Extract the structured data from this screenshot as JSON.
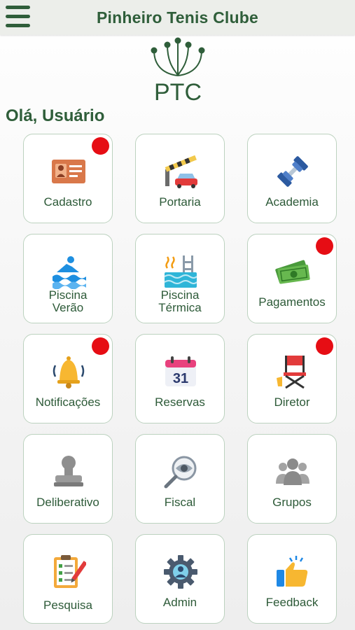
{
  "header": {
    "title": "Pinheiro Tenis Clube",
    "menu_icon": "hamburger-menu-icon"
  },
  "logo": {
    "text": "PTC"
  },
  "greeting": "Olá, Usuário",
  "colors": {
    "brand_green": "#2f5e3a",
    "badge_red": "#e60d14",
    "tile_border": "#bcd2bf"
  },
  "tiles": [
    {
      "label": "Cadastro",
      "icon": "id-card-icon",
      "badge": true
    },
    {
      "label": "Portaria",
      "icon": "gate-car-icon",
      "badge": false
    },
    {
      "label": "Academia",
      "icon": "dumbbell-icon",
      "badge": false
    },
    {
      "label": "Piscina Verão",
      "line1": "Piscina",
      "line2": "Verão",
      "icon": "swimmer-icon",
      "badge": false
    },
    {
      "label": "Piscina Térmica",
      "line1": "Piscina",
      "line2": "Térmica",
      "icon": "heated-pool-icon",
      "badge": false
    },
    {
      "label": "Pagamentos",
      "icon": "money-icon",
      "badge": true
    },
    {
      "label": "Notificações",
      "icon": "bell-icon",
      "badge": true
    },
    {
      "label": "Reservas",
      "icon": "calendar-icon",
      "badge": false
    },
    {
      "label": "Diretor",
      "icon": "director-chair-icon",
      "badge": true
    },
    {
      "label": "Deliberativo",
      "icon": "stamp-icon",
      "badge": false
    },
    {
      "label": "Fiscal",
      "icon": "magnifier-eye-icon",
      "badge": false
    },
    {
      "label": "Grupos",
      "icon": "group-icon",
      "badge": false
    },
    {
      "label": "Pesquisa",
      "icon": "checklist-icon",
      "badge": false
    },
    {
      "label": "Admin",
      "icon": "admin-gear-icon",
      "badge": false
    },
    {
      "label": "Feedback",
      "icon": "thumbs-up-icon",
      "badge": false
    },
    {
      "calendar_day": "31"
    }
  ]
}
